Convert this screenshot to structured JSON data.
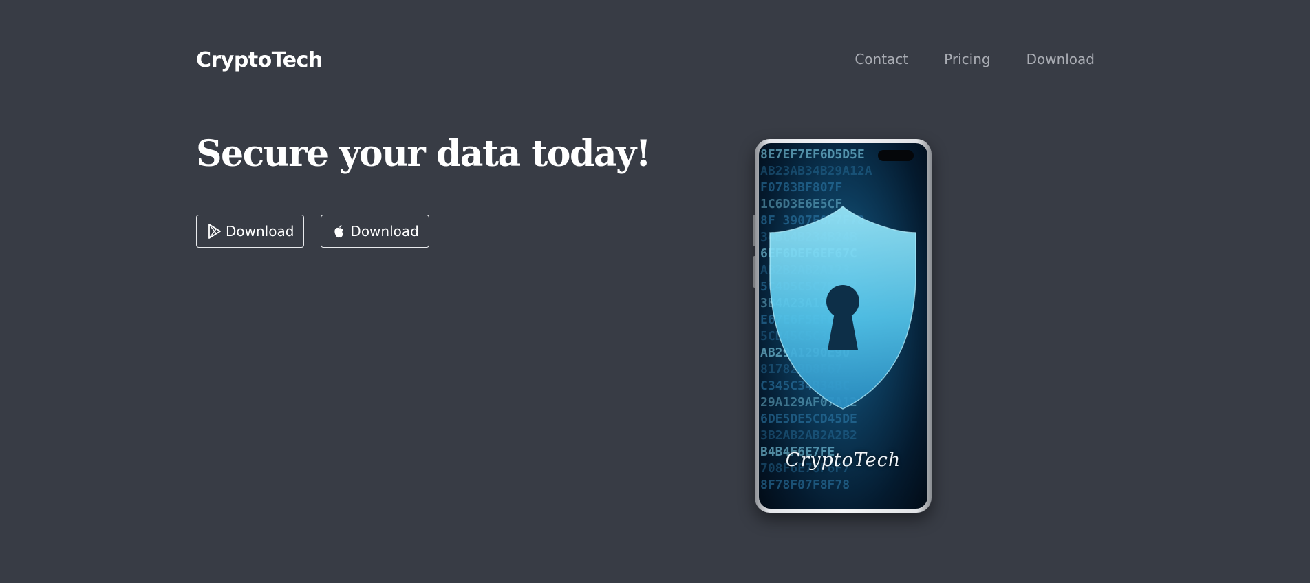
{
  "header": {
    "brand": "CryptoTech",
    "nav": [
      {
        "label": "Contact"
      },
      {
        "label": "Pricing"
      },
      {
        "label": "Download"
      }
    ]
  },
  "hero": {
    "title": "Secure your data today!",
    "buttons": [
      {
        "label": "Download",
        "icon": "google-play-icon"
      },
      {
        "label": "Download",
        "icon": "apple-icon"
      }
    ]
  },
  "phone": {
    "screen_logo_text": "CryptoTech",
    "screen_code_rows": [
      "8E7EF7EF6D5D5E",
      "AB23AB34B29A12A",
      "F0783BF807F",
      "1C6D3E6E5CF",
      "8F 3907F0F7F78",
      "34BC4B234B24B",
      "6EF6DEF6EF67C",
      "AB2B2AB2A123",
      "5C4D5C5C7EF67",
      "3B4A23A123429",
      "E67E6F5EF67",
      "5CD45C5C34",
      "AB29A1290E90",
      "81782BD8F67",
      "C345C34B34BC",
      "29A129AF07A12",
      "6DE5DE5CD45DE",
      "3B2AB2AB2A2B2",
      "B4B4F6E7FE",
      "708F6E78F6F7",
      "8F78F07F8F78"
    ],
    "colors": {
      "code_light": "#8fe6ff",
      "code_dim": "#2f7fb0",
      "shield": "#7bdcf4"
    }
  },
  "colors": {
    "background": "#383c45",
    "nav_text": "#a9acb3",
    "text": "#ffffff"
  }
}
